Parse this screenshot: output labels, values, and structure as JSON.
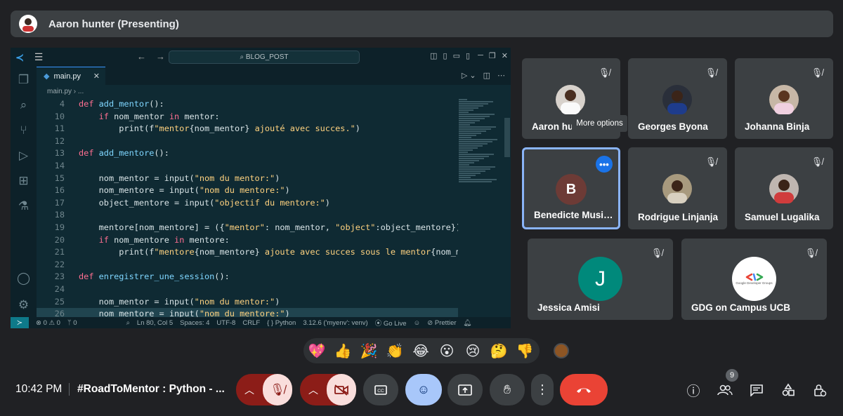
{
  "presenter": {
    "label": "Aaron hunter (Presenting)"
  },
  "vscode": {
    "search_text": "BLOG_POST",
    "tab_label": "main.py",
    "breadcrumb": "main.py › ...",
    "code_lines": [
      {
        "n": "4",
        "parts": [
          [
            "kw",
            "def "
          ],
          [
            "fn",
            "add_mentor"
          ],
          [
            "tx",
            "():"
          ]
        ]
      },
      {
        "n": "10",
        "parts": [
          [
            "tx",
            "    "
          ],
          [
            "kw",
            "if"
          ],
          [
            "tx",
            " nom_mentor "
          ],
          [
            "kw",
            "in"
          ],
          [
            "tx",
            " mentor:"
          ]
        ]
      },
      {
        "n": "11",
        "parts": [
          [
            "tx",
            "        print(f"
          ],
          [
            "st",
            "\"mentor"
          ],
          [
            "tx",
            "{nom_mentor}"
          ],
          [
            "st",
            " ajouté avec succes.\""
          ],
          [
            "tx",
            ")"
          ]
        ]
      },
      {
        "n": "12",
        "parts": [
          [
            "tx",
            ""
          ]
        ]
      },
      {
        "n": "13",
        "parts": [
          [
            "kw",
            "def "
          ],
          [
            "fn",
            "add_mentore"
          ],
          [
            "tx",
            "():"
          ]
        ]
      },
      {
        "n": "14",
        "parts": [
          [
            "tx",
            ""
          ]
        ]
      },
      {
        "n": "15",
        "parts": [
          [
            "tx",
            "    nom_mentor = input("
          ],
          [
            "st",
            "\"nom du mentor:\""
          ],
          [
            "tx",
            ")"
          ]
        ]
      },
      {
        "n": "16",
        "parts": [
          [
            "tx",
            "    nom_mentore = input("
          ],
          [
            "st",
            "\"nom du mentore:\""
          ],
          [
            "tx",
            ")"
          ]
        ]
      },
      {
        "n": "17",
        "parts": [
          [
            "tx",
            "    object_mentore = input("
          ],
          [
            "st",
            "\"objectif du mentore:\""
          ],
          [
            "tx",
            ")"
          ]
        ]
      },
      {
        "n": "18",
        "parts": [
          [
            "tx",
            ""
          ]
        ]
      },
      {
        "n": "19",
        "parts": [
          [
            "tx",
            "    mentore[nom_mentore] = ({"
          ],
          [
            "st",
            "\"mentor\""
          ],
          [
            "tx",
            ": nom_mentor, "
          ],
          [
            "st",
            "\"object\""
          ],
          [
            "tx",
            ":object_mentore})"
          ]
        ]
      },
      {
        "n": "20",
        "parts": [
          [
            "tx",
            "    "
          ],
          [
            "kw",
            "if"
          ],
          [
            "tx",
            " nom_mentore "
          ],
          [
            "kw",
            "in"
          ],
          [
            "tx",
            " mentore:"
          ]
        ]
      },
      {
        "n": "21",
        "parts": [
          [
            "tx",
            "        print(f"
          ],
          [
            "st",
            "\"mentore"
          ],
          [
            "tx",
            "{nom_mentore}"
          ],
          [
            "st",
            " ajoute avec succes sous le mentor"
          ],
          [
            "tx",
            "{nom_mentor}"
          ],
          [
            "st",
            " \""
          ],
          [
            "tx",
            ")"
          ]
        ]
      },
      {
        "n": "22",
        "parts": [
          [
            "tx",
            ""
          ]
        ]
      },
      {
        "n": "23",
        "parts": [
          [
            "kw",
            "def "
          ],
          [
            "fn",
            "enregistrer_une_session"
          ],
          [
            "tx",
            "():"
          ]
        ]
      },
      {
        "n": "24",
        "parts": [
          [
            "tx",
            ""
          ]
        ]
      },
      {
        "n": "25",
        "parts": [
          [
            "tx",
            "    nom_mentor = input("
          ],
          [
            "st",
            "\"nom du mentor:\""
          ],
          [
            "tx",
            ")"
          ]
        ]
      },
      {
        "n": "26",
        "parts": [
          [
            "tx",
            "    nom_mentore = input("
          ],
          [
            "st",
            "\"nom du mentore:\""
          ],
          [
            "tx",
            ")"
          ]
        ]
      }
    ],
    "status": {
      "problems": "⊗ 0 ⚠ 0",
      "ports": "ᛘ 0",
      "position": "Ln 80, Col 5",
      "spaces": "Spaces: 4",
      "encoding": "UTF-8",
      "eol": "CRLF",
      "language": "{ } Python",
      "interpreter": "3.12.6 ('myenv': venv)",
      "golive": "Go Live",
      "prettier": "Prettier"
    }
  },
  "participants": [
    {
      "name": "Aaron hu",
      "muted": true
    },
    {
      "name": "Georges Byona",
      "muted": true
    },
    {
      "name": "Johanna Binja",
      "muted": true
    },
    {
      "name": "Benedicte Musi…",
      "initial": "B",
      "muted": true,
      "active": true
    },
    {
      "name": "Rodrigue Linjanja",
      "muted": true
    },
    {
      "name": "Samuel Lugalika",
      "muted": true
    },
    {
      "name": "Jessica Amisi",
      "initial": "J",
      "muted": true
    },
    {
      "name": "GDG on Campus UCB",
      "muted": true,
      "logo_text": "Google Developer Groups"
    }
  ],
  "tooltip": "More options",
  "reactions": [
    "💖",
    "👍",
    "🎉",
    "👏",
    "😂",
    "😮",
    "😢",
    "🤔",
    "👎"
  ],
  "bottom": {
    "time": "10:42 PM",
    "meeting_title": "#RoadToMentor : Python - ...",
    "people_count": "9"
  },
  "colors": {
    "end_call": "#ea4335",
    "muted_bg": "#f9dedc",
    "muted_chevron": "#8c1d18",
    "accent": "#8ab4f8"
  }
}
